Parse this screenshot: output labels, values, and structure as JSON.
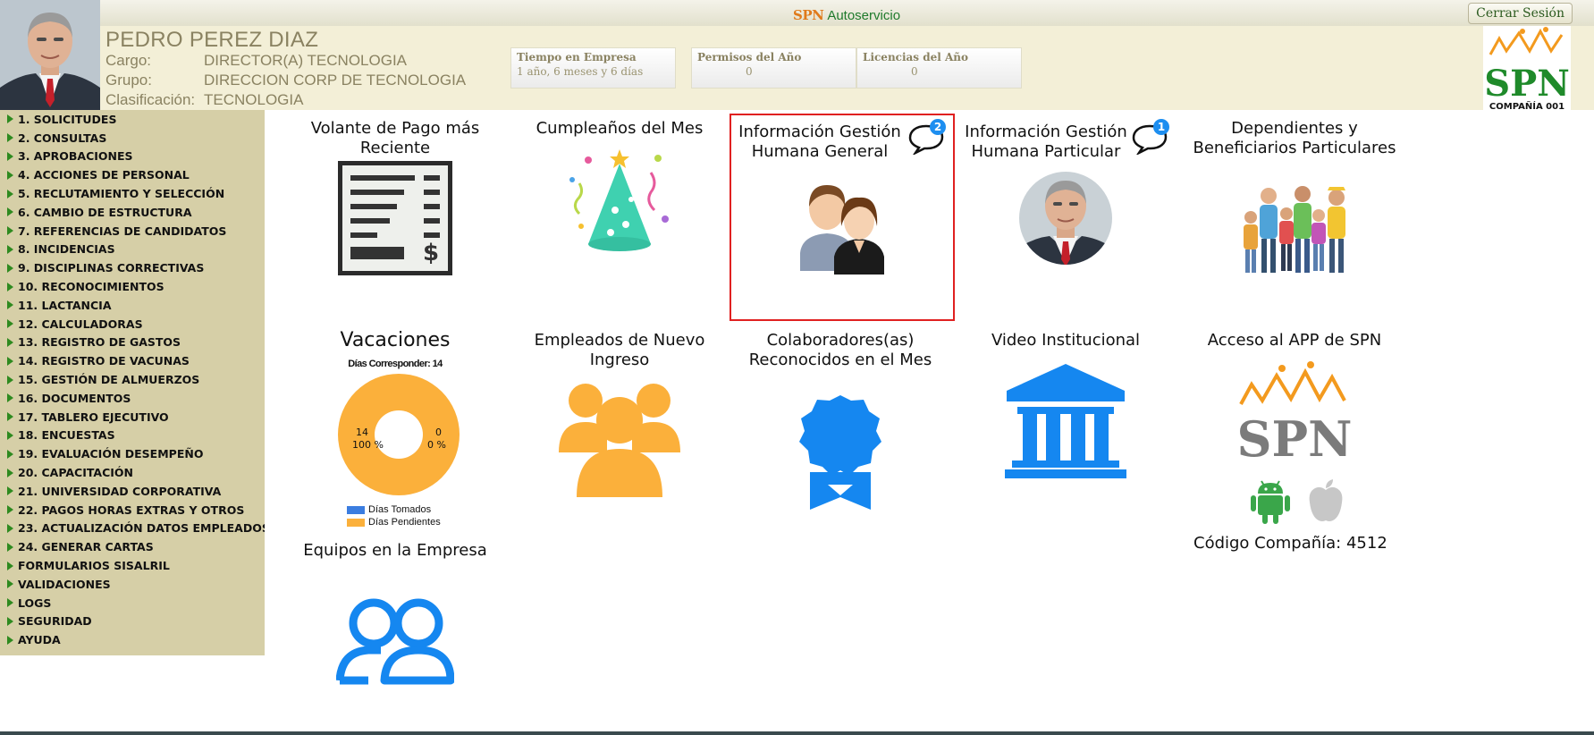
{
  "topbar": {
    "brand_logo": "SPN",
    "brand_text": "Autoservicio",
    "logout_label": "Cerrar Sesión"
  },
  "employee": {
    "name": "PEDRO PEREZ DIAZ",
    "fields": [
      {
        "label": "Cargo:",
        "value": "DIRECTOR(A) TECNOLOGIA"
      },
      {
        "label": "Grupo:",
        "value": "DIRECCION CORP DE TECNOLOGIA"
      },
      {
        "label": "Clasificación:",
        "value": "TECNOLOGIA"
      }
    ]
  },
  "stats": [
    {
      "title": "Tiempo en Empresa",
      "value": "1 año, 6 meses y 6 días"
    },
    {
      "title": "Permisos del Año",
      "value": "0"
    },
    {
      "title": "Licencias del Año",
      "value": "0"
    }
  ],
  "company": {
    "logo_text": "SPN",
    "caption": "COMPAÑÍA 001"
  },
  "sidebar": {
    "items": [
      "1. SOLICITUDES",
      "2. CONSULTAS",
      "3. APROBACIONES",
      "4. ACCIONES DE PERSONAL",
      "5. RECLUTAMIENTO Y SELECCIÓN",
      "6. CAMBIO DE ESTRUCTURA",
      "7. REFERENCIAS DE CANDIDATOS",
      "8. INCIDENCIAS",
      "9. DISCIPLINAS CORRECTIVAS",
      "10. RECONOCIMIENTOS",
      "11. LACTANCIA",
      "12. CALCULADORAS",
      "13. REGISTRO DE GASTOS",
      "14. REGISTRO DE VACUNAS",
      "15. GESTIÓN DE ALMUERZOS",
      "16. DOCUMENTOS",
      "17. TABLERO EJECUTIVO",
      "18. ENCUESTAS",
      "19. EVALUACIÓN DESEMPEÑO",
      "20. CAPACITACIÓN",
      "21. UNIVERSIDAD CORPORATIVA",
      "22. PAGOS HORAS EXTRAS Y OTROS",
      "23. ACTUALIZACIÓN DATOS EMPLEADOS",
      "24. GENERAR CARTAS",
      "FORMULARIOS SISALRIL",
      "VALIDACIONES",
      "LOGS",
      "SEGURIDAD",
      "AYUDA"
    ]
  },
  "tiles": {
    "payslip": "Volante de Pago más Reciente",
    "birthdays": "Cumpleaños del Mes",
    "info_general": {
      "title": "Información Gestión Humana General",
      "badge": "2"
    },
    "info_particular": {
      "title": "Información Gestión Humana Particular",
      "badge": "1"
    },
    "dependents": "Dependientes y Beneficiarios Particulares",
    "vacations": {
      "title": "Vacaciones",
      "chart_caption": "Días Corresponder: 14",
      "left_count": "14",
      "left_pct": "100 %",
      "right_count": "0",
      "right_pct": "0 %",
      "legend": [
        "Días Tomados",
        "Días Pendientes"
      ]
    },
    "new_hires": "Empleados de Nuevo Ingreso",
    "recognized": "Colaboradores(as) Reconocidos en el Mes",
    "video": "Video Institucional",
    "app": "Acceso al APP de SPN",
    "company_code": "Código Compañía: 4512",
    "teams": "Equipos en la Empresa"
  },
  "chart_data": {
    "type": "pie",
    "title": "Días Corresponder: 14",
    "categories": [
      "Días Tomados",
      "Días Pendientes"
    ],
    "values": [
      0,
      14
    ],
    "colors": [
      "#3b7de0",
      "#fbb03b"
    ]
  },
  "colors": {
    "sidebar_bg": "#d6cfa7",
    "header_bg": "#f3efd7",
    "icon_blue": "#1587f0",
    "icon_orange": "#fbb03b",
    "selected_border": "#e02020"
  }
}
